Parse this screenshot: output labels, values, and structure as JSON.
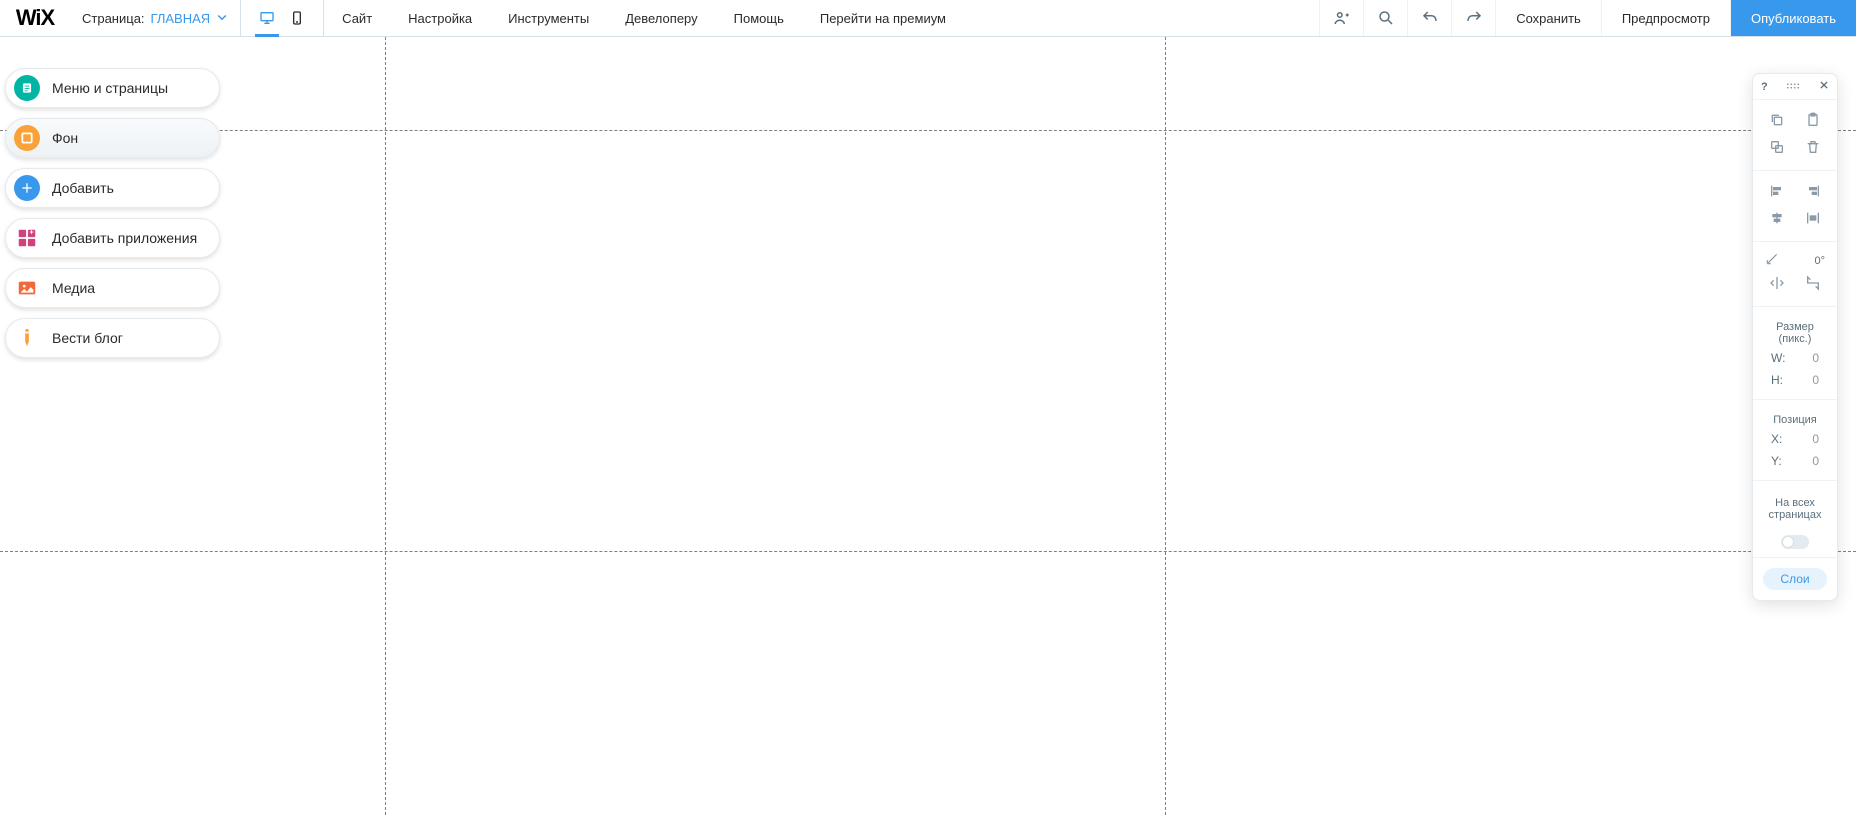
{
  "topbar": {
    "page_label": "Страница:",
    "page_name": "ГЛАВНАЯ",
    "menus": [
      "Сайт",
      "Настройка",
      "Инструменты",
      "Девелоперу",
      "Помощь",
      "Перейти на премиум"
    ],
    "save": "Сохранить",
    "preview": "Предпросмотр",
    "publish": "Опубликовать"
  },
  "sidebar": {
    "items": [
      {
        "label": "Меню и страницы"
      },
      {
        "label": "Фон"
      },
      {
        "label": "Добавить"
      },
      {
        "label": "Добавить приложения"
      },
      {
        "label": "Медиа"
      },
      {
        "label": "Вести блог"
      }
    ]
  },
  "inspector": {
    "rotation": "0°",
    "size_label": "Размер (пикс.)",
    "w_label": "W:",
    "h_label": "H:",
    "w_value": "0",
    "h_value": "0",
    "pos_label": "Позиция",
    "x_label": "X:",
    "y_label": "Y:",
    "x_value": "0",
    "y_value": "0",
    "all_pages": "На всех страницах",
    "layers": "Слои",
    "help": "?"
  }
}
